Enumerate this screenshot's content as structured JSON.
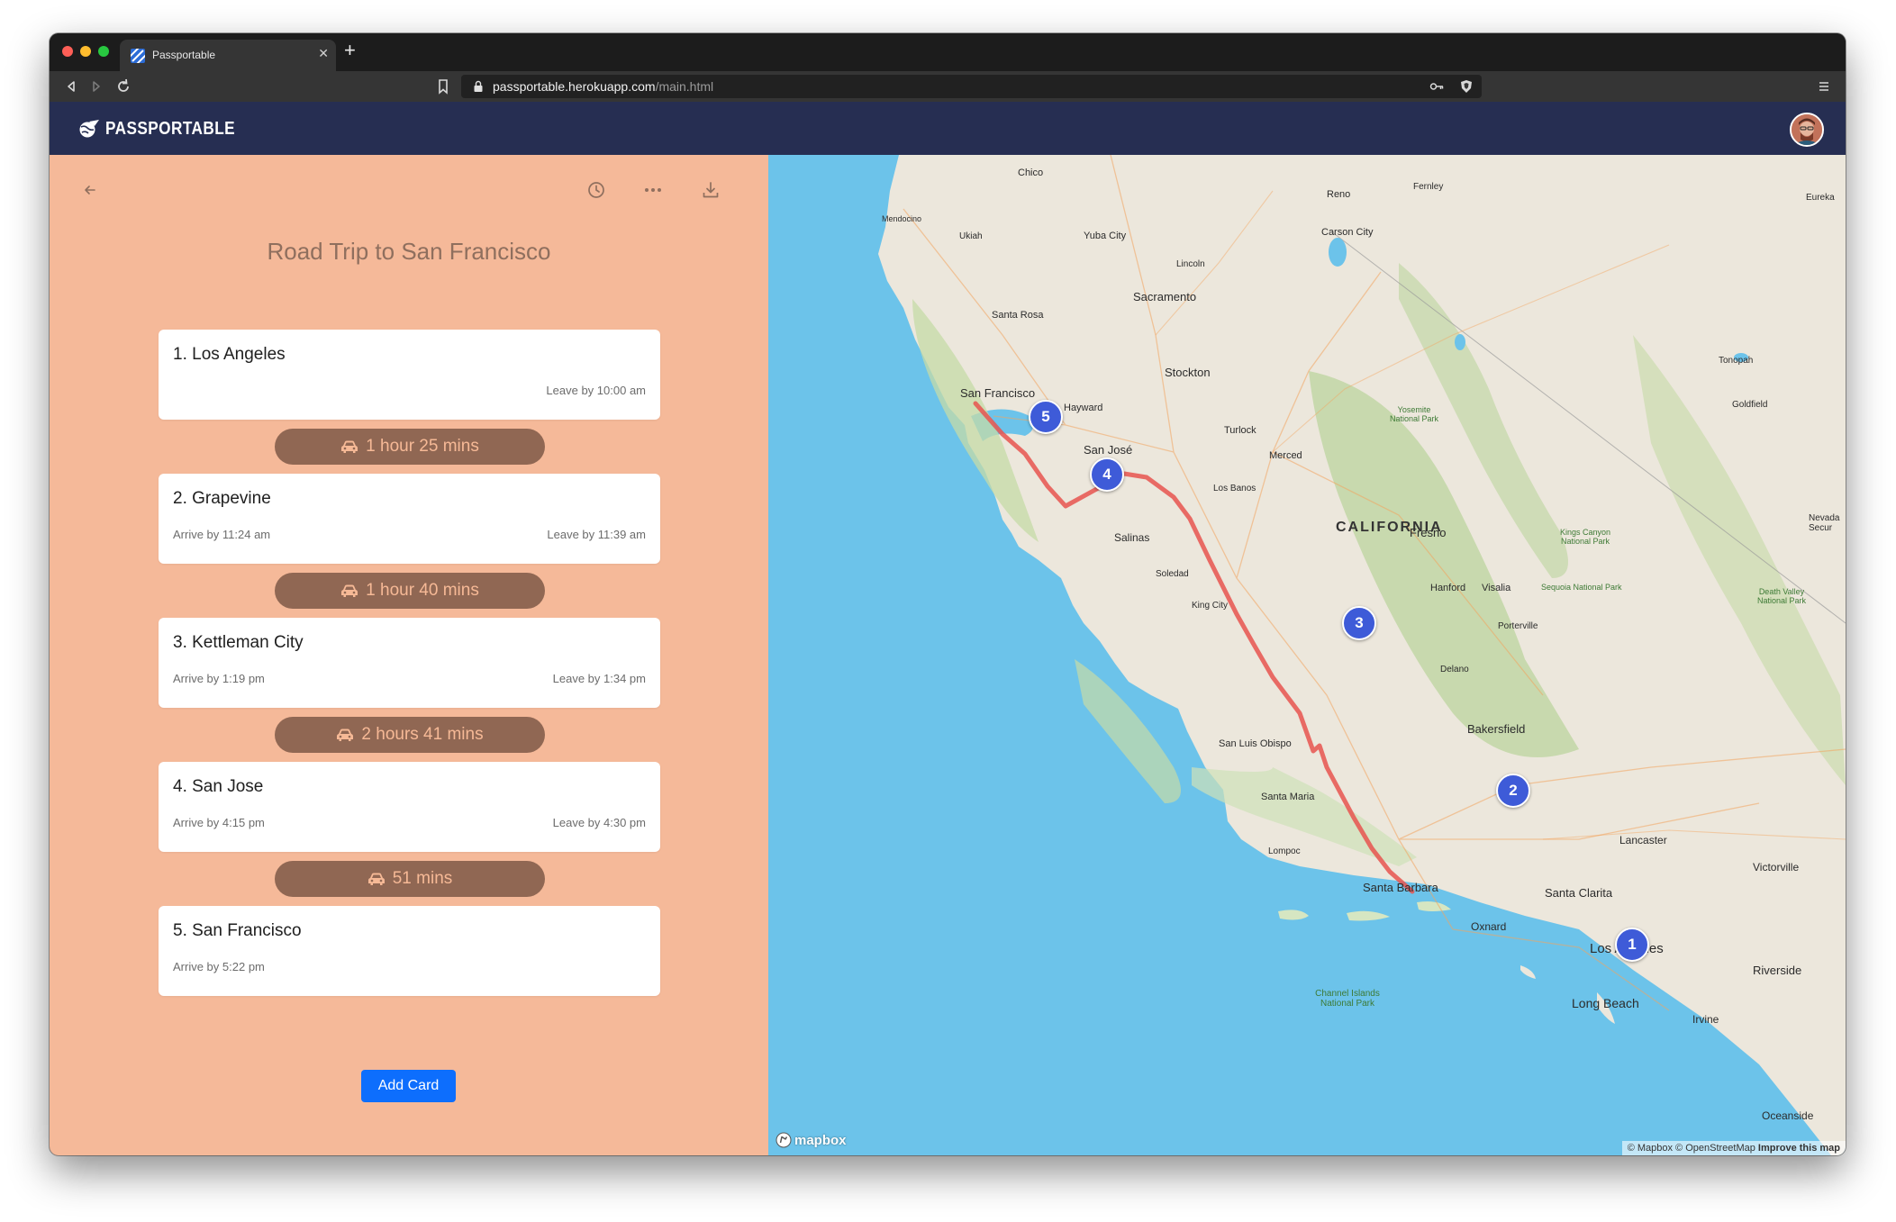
{
  "browser": {
    "tab_title": "Passportable",
    "url_host": "passportable.herokuapp.com",
    "url_path": "/main.html"
  },
  "app": {
    "brand": "PASSPORTABLE"
  },
  "trip": {
    "title": "Road Trip to San Francisco",
    "stops": [
      {
        "name": "1. Los Angeles",
        "arrive": "",
        "leave": "Leave by 10:00 am"
      },
      {
        "name": "2. Grapevine",
        "arrive": "Arrive by 11:24 am",
        "leave": "Leave by 11:39 am"
      },
      {
        "name": "3. Kettleman City",
        "arrive": "Arrive by 1:19 pm",
        "leave": "Leave by 1:34 pm"
      },
      {
        "name": "4. San Jose",
        "arrive": "Arrive by 4:15 pm",
        "leave": "Leave by 4:30 pm"
      },
      {
        "name": "5. San Francisco",
        "arrive": "Arrive by 5:22 pm",
        "leave": ""
      }
    ],
    "drives": [
      "1 hour 25 mins",
      "1 hour 40 mins",
      "2 hours 41 mins",
      "51 mins"
    ],
    "add_card_label": "Add Card"
  },
  "map": {
    "labels": [
      "Chico",
      "Reno",
      "Fernley",
      "Mendocino",
      "Ukiah",
      "Yuba City",
      "Carson City",
      "Lincoln",
      "Sacramento",
      "Santa Rosa",
      "Stockton",
      "San Francisco",
      "Hayward",
      "San José",
      "Turlock",
      "Merced",
      "Los Banos",
      "Yosemite National Park",
      "Tonopah",
      "Goldfield",
      "CALIFORNIA",
      "Fresno",
      "Salinas",
      "Soledad",
      "King City",
      "Kings Canyon National Park",
      "Hanford",
      "Visalia",
      "Sequoia National Park",
      "Death Valley National Park",
      "Porterville",
      "Delano",
      "Bakersfield",
      "San Luis Obispo",
      "Santa Maria",
      "Lompoc",
      "Santa Barbara",
      "Lancaster",
      "Santa Clarita",
      "Victorville",
      "Oxnard",
      "Los Angeles",
      "Long Beach",
      "Riverside",
      "Irvine",
      "Channel Islands National Park",
      "Oceanside",
      "Eureka",
      "Nevada Secur"
    ],
    "markers": [
      "1",
      "2",
      "3",
      "4",
      "5"
    ],
    "attribution_prefix": "© Mapbox © OpenStreetMap",
    "attribution_link": "Improve this map",
    "logo_text": "mapbox"
  },
  "colors": {
    "panel_bg": "#f5b999",
    "drive_pill": "#906753",
    "header_bg": "#262e52",
    "route": "#e8534f",
    "marker": "#3e5bd8",
    "ocean": "#6cc3ea",
    "land": "#ece7dc",
    "button": "#0d6efd"
  }
}
